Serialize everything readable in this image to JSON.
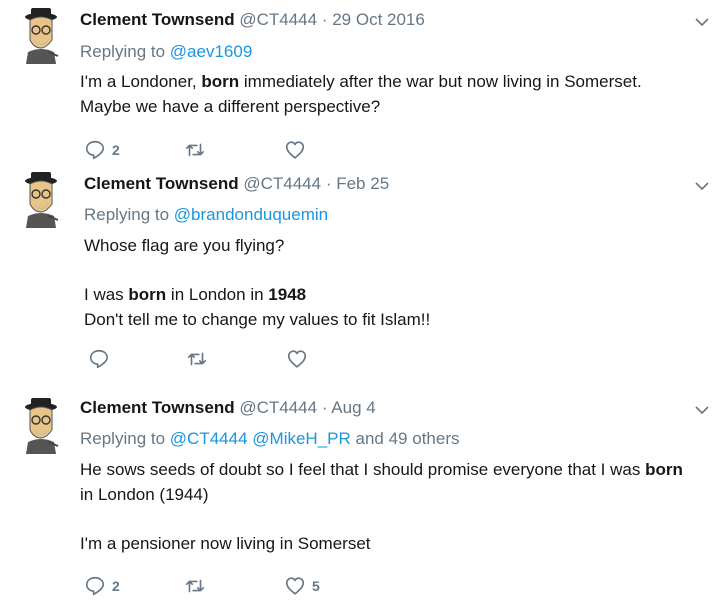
{
  "tweets": [
    {
      "name": "Clement Townsend",
      "handle": "@CT4444",
      "dot": "·",
      "date": "29 Oct 2016",
      "replying_prefix": "Replying to",
      "replying_links": [
        "@aev1609"
      ],
      "replying_suffix": "",
      "lines": [
        [
          "I'm a Londoner, ",
          "born",
          " immediately after the war but now living in Somerset."
        ],
        [
          "Maybe we have a different perspective?"
        ]
      ],
      "counts": {
        "reply": "2",
        "retweet": "",
        "like": ""
      }
    },
    {
      "name": "Clement Townsend",
      "handle": "@CT4444",
      "dot": "·",
      "date": "Feb 25",
      "replying_prefix": "Replying to",
      "replying_links": [
        "@brandonduquemin"
      ],
      "replying_suffix": "",
      "lines": [
        [
          "Whose flag are you flying?"
        ],
        [],
        [
          "I was ",
          "born",
          " in London in ",
          "1948"
        ],
        [
          "Don't tell me to change my values to fit Islam!!"
        ]
      ],
      "counts": {
        "reply": "",
        "retweet": "",
        "like": ""
      }
    },
    {
      "name": "Clement Townsend",
      "handle": "@CT4444",
      "dot": "·",
      "date": "Aug 4",
      "replying_prefix": "Replying to",
      "replying_links": [
        "@CT4444",
        "@MikeH_PR"
      ],
      "replying_suffix": "and 49 others",
      "lines": [
        [
          "He sows seeds of doubt so I feel that I should promise everyone that I was ",
          "born"
        ],
        [
          "in London (1944)"
        ],
        [],
        [
          "I'm a pensioner now living in Somerset"
        ]
      ],
      "counts": {
        "reply": "2",
        "retweet": "",
        "like": "5"
      }
    }
  ],
  "icons": {
    "avatar": "cartoon-man-hat-glasses-icon",
    "menu": "chevron-down-icon",
    "reply": "reply-icon",
    "retweet": "retweet-icon",
    "like": "heart-icon"
  },
  "colors": {
    "name": "#14171a",
    "meta": "#657786",
    "link": "#1b95e0",
    "text": "#14171a"
  }
}
